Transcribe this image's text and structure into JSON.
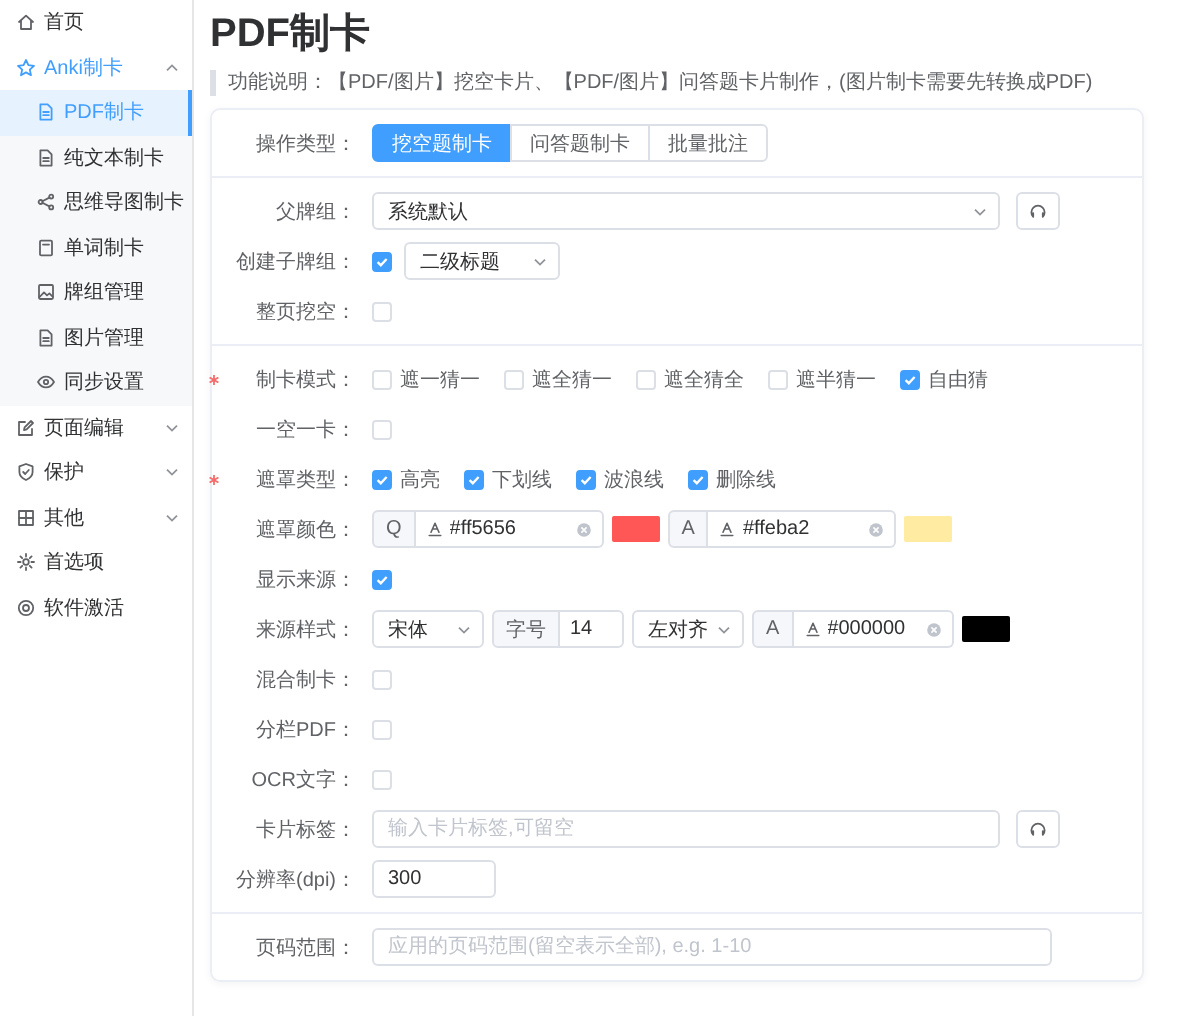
{
  "sidebar": {
    "items": [
      {
        "label": "首页",
        "selected": false
      },
      {
        "label": "Anki制卡",
        "selected": false,
        "expanded": true,
        "children": [
          {
            "label": "PDF制卡",
            "selected": true
          },
          {
            "label": "纯文本制卡",
            "selected": false
          },
          {
            "label": "思维导图制卡",
            "selected": false
          },
          {
            "label": "单词制卡",
            "selected": false
          },
          {
            "label": "牌组管理",
            "selected": false
          },
          {
            "label": "图片管理",
            "selected": false
          },
          {
            "label": "同步设置",
            "selected": false
          }
        ]
      },
      {
        "label": "页面编辑",
        "selected": false,
        "expanded": false
      },
      {
        "label": "保护",
        "selected": false,
        "expanded": false
      },
      {
        "label": "其他",
        "selected": false,
        "expanded": false
      },
      {
        "label": "首选项",
        "selected": false
      },
      {
        "label": "软件激活",
        "selected": false
      }
    ]
  },
  "header": {
    "title": "PDF制卡",
    "description": "功能说明：【PDF/图片】挖空卡片、【PDF/图片】问答题卡片制作，(图片制卡需要先转换成PDF)"
  },
  "form": {
    "sections": [
      {
        "rows": [
          {
            "kind": "segmented",
            "label": "操作类型：",
            "required": false,
            "options": [
              {
                "label": "挖空题制卡",
                "selected": true
              },
              {
                "label": "问答题制卡",
                "selected": false
              },
              {
                "label": "批量批注",
                "selected": false
              }
            ]
          }
        ]
      },
      {
        "rows": [
          {
            "kind": "select_refresh",
            "label": "父牌组：",
            "required": false,
            "value": "系统默认"
          },
          {
            "kind": "checkbox_select",
            "label": "创建子牌组：",
            "required": false,
            "checked": true,
            "value": "二级标题"
          },
          {
            "kind": "checkbox",
            "label": "整页挖空：",
            "required": false,
            "checked": false
          }
        ]
      },
      {
        "rows": [
          {
            "kind": "checkbox_group",
            "label": "制卡模式：",
            "required": true,
            "options": [
              {
                "label": "遮一猜一",
                "checked": false
              },
              {
                "label": "遮全猜一",
                "checked": false
              },
              {
                "label": "遮全猜全",
                "checked": false
              },
              {
                "label": "遮半猜一",
                "checked": false
              },
              {
                "label": "自由猜",
                "checked": true
              }
            ]
          },
          {
            "kind": "checkbox",
            "label": "一空一卡：",
            "required": false,
            "checked": false
          },
          {
            "kind": "checkbox_group",
            "label": "遮罩类型：",
            "required": true,
            "options": [
              {
                "label": "高亮",
                "checked": true
              },
              {
                "label": "下划线",
                "checked": true
              },
              {
                "label": "波浪线",
                "checked": true
              },
              {
                "label": "删除线",
                "checked": true
              }
            ]
          },
          {
            "kind": "color_pair",
            "label": "遮罩颜色：",
            "required": false,
            "colors": [
              {
                "prefix": "Q",
                "value": "#ff5656",
                "color": "#ff5656"
              },
              {
                "prefix": "A",
                "value": "#ffeba2",
                "color": "#ffeba2"
              }
            ]
          },
          {
            "kind": "checkbox",
            "label": "显示来源：",
            "required": false,
            "checked": true
          },
          {
            "kind": "source_style",
            "label": "来源样式：",
            "required": false,
            "font": "宋体",
            "size_label": "字号",
            "size": "14",
            "align": "左对齐",
            "color": {
              "prefix": "A",
              "value": "#000000",
              "color": "#000000"
            }
          },
          {
            "kind": "checkbox",
            "label": "混合制卡：",
            "required": false,
            "checked": false
          },
          {
            "kind": "checkbox",
            "label": "分栏PDF：",
            "required": false,
            "checked": false
          },
          {
            "kind": "checkbox",
            "label": "OCR文字：",
            "required": false,
            "checked": false
          },
          {
            "kind": "input_refresh",
            "label": "卡片标签：",
            "required": false,
            "placeholder": "输入卡片标签,可留空"
          },
          {
            "kind": "number",
            "label": "分辨率(dpi)：",
            "required": false,
            "value": "300"
          }
        ]
      },
      {
        "rows": [
          {
            "kind": "text",
            "label": "页码范围：",
            "required": false,
            "placeholder": "应用的页码范围(留空表示全部), e.g. 1-10"
          }
        ]
      }
    ]
  }
}
